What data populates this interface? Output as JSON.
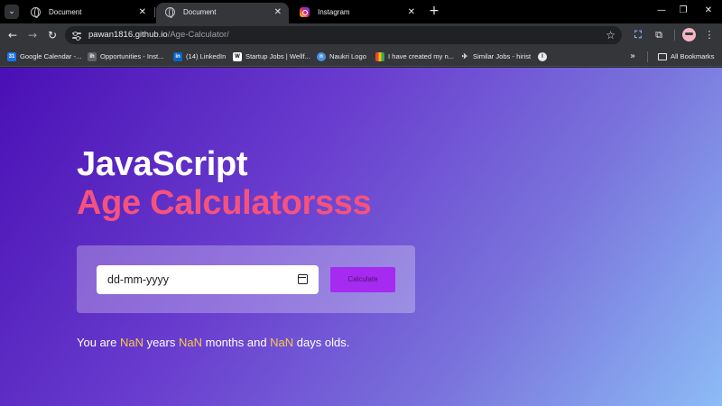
{
  "browser": {
    "tabs": [
      {
        "title": "Document",
        "favicon": "globe-icon",
        "active": false
      },
      {
        "title": "Document",
        "favicon": "globe-icon",
        "active": true
      },
      {
        "title": "Instagram",
        "favicon": "instagram-icon",
        "active": false
      }
    ],
    "address": {
      "host": "pawan1816.github.io",
      "path": "/Age-Calculator/"
    },
    "bookmarks": [
      {
        "label": "Google Calendar -...",
        "icon": "calendar-icon",
        "color": "#1a73e8"
      },
      {
        "label": "Opportunities - Inst...",
        "icon": "ih-icon",
        "color": "#5f6368"
      },
      {
        "label": "(14) LinkedIn",
        "icon": "linkedin-icon",
        "color": "#0a66c2"
      },
      {
        "label": "Startup Jobs | Wellf...",
        "icon": "wellfound-icon",
        "color": "#ffffff"
      },
      {
        "label": "Naukri Logo",
        "icon": "naukri-icon",
        "color": "#4a90e2"
      },
      {
        "label": "I have created my n...",
        "icon": "bars-icon",
        "color": "#e8453c"
      },
      {
        "label": "Similar Jobs - hirist",
        "icon": "runner-icon",
        "color": "#e8eaed"
      }
    ],
    "all_bookmarks_label": "All Bookmarks"
  },
  "page": {
    "title_line1": "JavaScript",
    "title_line2": "Age Calculatorsss",
    "date_placeholder": "dd-mm-yyyy",
    "button_label": "Calculate",
    "result": {
      "prefix": "You are ",
      "years": "NaN",
      "years_label": " years ",
      "months": "NaN",
      "months_label": " months and ",
      "days": "NaN",
      "days_label": " days olds."
    },
    "colors": {
      "accent": "#f5527e",
      "button": "#a52bf0",
      "highlight": "#f7c948",
      "gradient_start": "#4a0fb5",
      "gradient_end": "#8cbcf6"
    }
  }
}
